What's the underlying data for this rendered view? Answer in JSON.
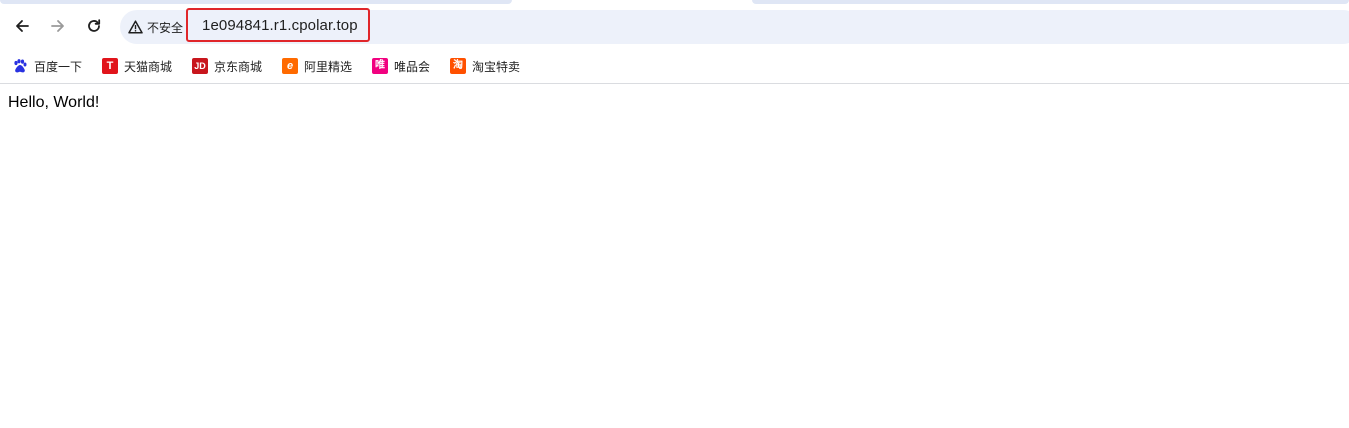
{
  "toolbar": {
    "back_icon": "arrow-left-icon",
    "forward_icon": "arrow-right-icon",
    "reload_icon": "reload-icon",
    "security_text": "不安全",
    "url": "1e094841.r1.cpolar.top",
    "highlight_color": "#e0262a"
  },
  "bookmarks": [
    {
      "label": "百度一下",
      "icon": "baidu-icon"
    },
    {
      "label": "天猫商城",
      "icon": "tmall-icon",
      "glyph": "T"
    },
    {
      "label": "京东商城",
      "icon": "jd-icon",
      "glyph": "JD"
    },
    {
      "label": "阿里精选",
      "icon": "aliexpress-icon",
      "glyph": "e"
    },
    {
      "label": "唯品会",
      "icon": "vip-icon",
      "glyph": "唯"
    },
    {
      "label": "淘宝特卖",
      "icon": "taobao-icon",
      "glyph": "淘"
    }
  ],
  "content": {
    "text": "Hello, World!"
  }
}
